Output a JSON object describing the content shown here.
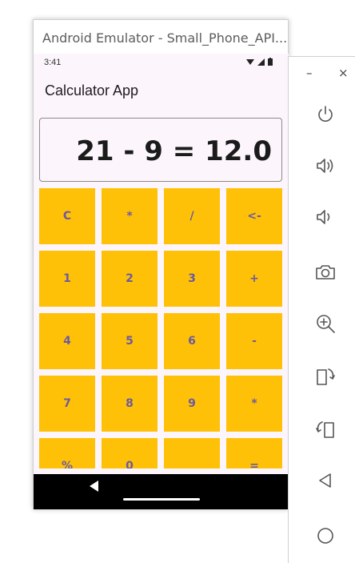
{
  "window": {
    "title": "Android Emulator - Small_Phone_API..."
  },
  "status_bar": {
    "time": "3:41"
  },
  "app": {
    "title": "Calculator App",
    "display": "21 - 9 = 12.0",
    "keys": [
      "C",
      "*",
      "/",
      "<-",
      "1",
      "2",
      "3",
      "+",
      "4",
      "5",
      "6",
      "-",
      "7",
      "8",
      "9",
      "*",
      "%",
      "0",
      "",
      "="
    ]
  },
  "side_panel": {
    "minimize": "–",
    "close": "×"
  },
  "colors": {
    "key_bg": "#ffc107",
    "key_text": "#6b5aa0",
    "screen_bg": "#fcf6fc",
    "nav_bg": "#000000"
  },
  "icons": [
    "power-icon",
    "volume-up-icon",
    "volume-down-icon",
    "camera-icon",
    "zoom-icon",
    "rotate-right-icon",
    "rotate-left-icon",
    "back-icon",
    "home-icon"
  ]
}
